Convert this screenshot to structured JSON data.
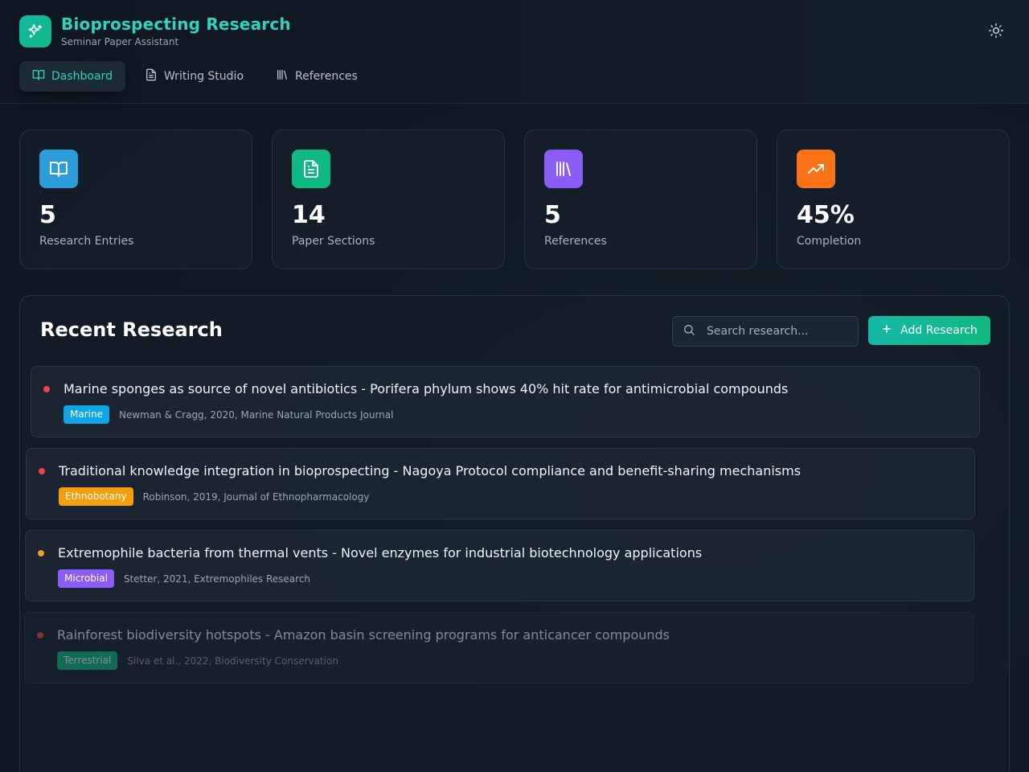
{
  "app": {
    "title": "Bioprospecting Research",
    "subtitle": "Seminar Paper Assistant"
  },
  "nav": {
    "tabs": [
      {
        "label": "Dashboard",
        "active": true
      },
      {
        "label": "Writing Studio",
        "active": false
      },
      {
        "label": "References",
        "active": false
      }
    ]
  },
  "stats": [
    {
      "value": "5",
      "label": "Research Entries",
      "color": "#2d9cdb"
    },
    {
      "value": "14",
      "label": "Paper Sections",
      "color": "#10b981"
    },
    {
      "value": "5",
      "label": "References",
      "color": "#8b5cf6"
    },
    {
      "value": "45%",
      "label": "Completion",
      "color": "#f97316"
    }
  ],
  "recent": {
    "title": "Recent Research",
    "search_placeholder": "Search research...",
    "add_label": "Add Research",
    "entries": [
      {
        "title": "Marine sponges as source of novel antibiotics - Porifera phylum shows 40% hit rate for antimicrobial compounds",
        "tag": "Marine",
        "tag_color": "#0ea5e9",
        "citation": "Newman & Cragg, 2020, Marine Natural Products Journal",
        "dot_color": "#ef4444"
      },
      {
        "title": "Traditional knowledge integration in bioprospecting - Nagoya Protocol compliance and benefit-sharing mechanisms",
        "tag": "Ethnobotany",
        "tag_color": "#f59e0b",
        "citation": "Robinson, 2019, Journal of Ethnopharmacology",
        "dot_color": "#ef4444"
      },
      {
        "title": "Extremophile bacteria from thermal vents - Novel enzymes for industrial biotechnology applications",
        "tag": "Microbial",
        "tag_color": "#8b5cf6",
        "citation": "Stetter, 2021, Extremophiles Research",
        "dot_color": "#f59e0b"
      },
      {
        "title": "Rainforest biodiversity hotspots - Amazon basin screening programs for anticancer compounds",
        "tag": "Terrestrial",
        "tag_color": "#10b981",
        "citation": "Silva et al., 2022, Biodiversity Conservation",
        "dot_color": "#ef4444"
      }
    ]
  }
}
